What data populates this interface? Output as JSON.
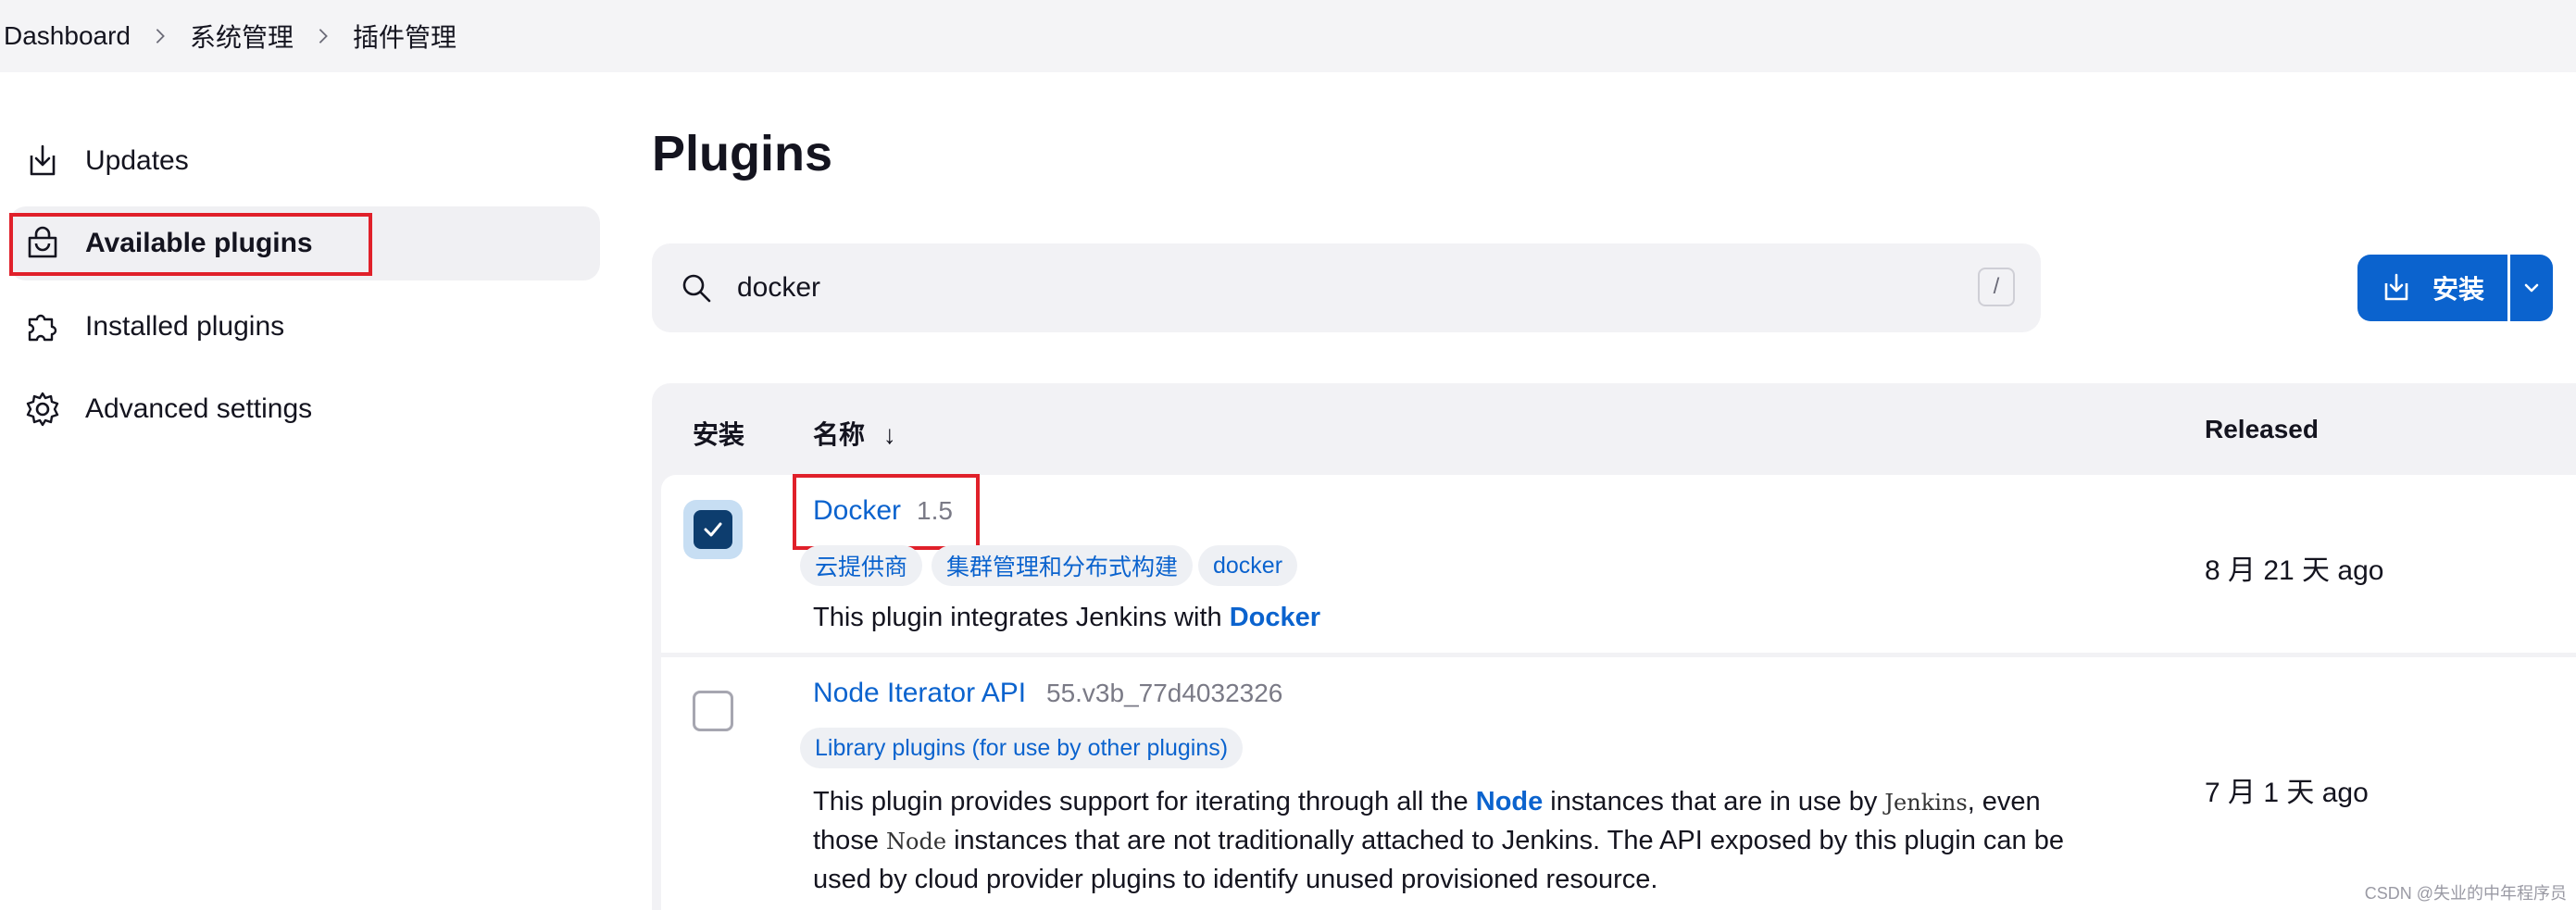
{
  "breadcrumb": [
    "Dashboard",
    "系统管理",
    "插件管理"
  ],
  "sidebar": {
    "items": [
      {
        "label": "Updates",
        "icon": "download-icon"
      },
      {
        "label": "Available plugins",
        "icon": "shopping-bag-icon"
      },
      {
        "label": "Installed plugins",
        "icon": "puzzle-icon"
      },
      {
        "label": "Advanced settings",
        "icon": "gear-icon"
      }
    ],
    "active_index": 1
  },
  "main": {
    "title": "Plugins",
    "search": {
      "value": "docker",
      "shortcut": "/"
    },
    "install_button": {
      "label": "安装"
    },
    "table": {
      "headers": {
        "install": "安装",
        "name": "名称",
        "sort_arrow": "↓",
        "released": "Released"
      },
      "rows": [
        {
          "checked": true,
          "name": "Docker",
          "version": "1.5",
          "tags": [
            "云提供商",
            "集群管理和分布式构建",
            "docker"
          ],
          "description": {
            "prefix": "This plugin integrates Jenkins with ",
            "link": "Docker"
          },
          "released": "8 月 21 天 ago"
        },
        {
          "checked": false,
          "name": "Node Iterator API",
          "version": "55.v3b_77d4032326",
          "tags": [
            "Library plugins (for use by other plugins)"
          ],
          "description": {
            "p1": "This plugin provides support for iterating through all the ",
            "link": "Node",
            "p2": " instances that are in use by ",
            "code1": "Jenkins",
            "p3": ", even",
            "p4": "those ",
            "code2": "Node",
            "p5": " instances that are not traditionally attached to Jenkins. The API exposed by this plugin can be",
            "p6": "used by cloud provider plugins to identify unused provisioned resource."
          },
          "released": "7 月 1 天 ago"
        }
      ]
    }
  },
  "watermark": "CSDN @失业的中年程序员",
  "colors": {
    "accent": "#0b63ce",
    "highlight_box": "#e0202a",
    "checkbox_checked": "#0d3d6e"
  }
}
